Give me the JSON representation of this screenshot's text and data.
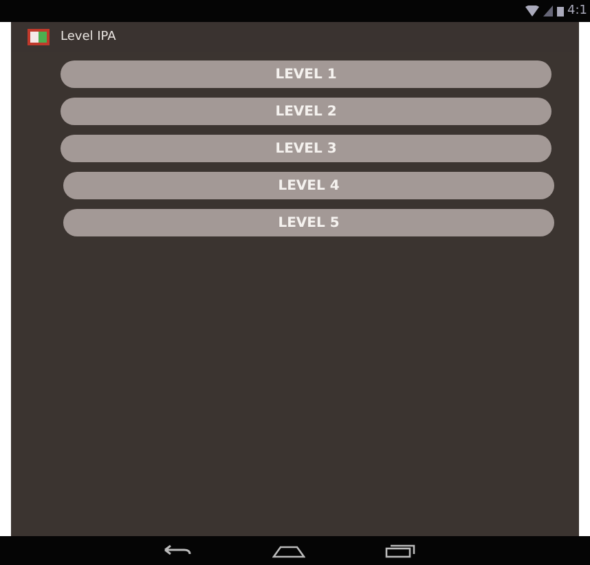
{
  "status_bar": {
    "time": "4:1"
  },
  "app_bar": {
    "title": "Level IPA"
  },
  "levels": [
    {
      "label": "LEVEL 1"
    },
    {
      "label": "LEVEL 2"
    },
    {
      "label": "LEVEL 3"
    },
    {
      "label": "LEVEL 4"
    },
    {
      "label": "LEVEL 5"
    }
  ]
}
